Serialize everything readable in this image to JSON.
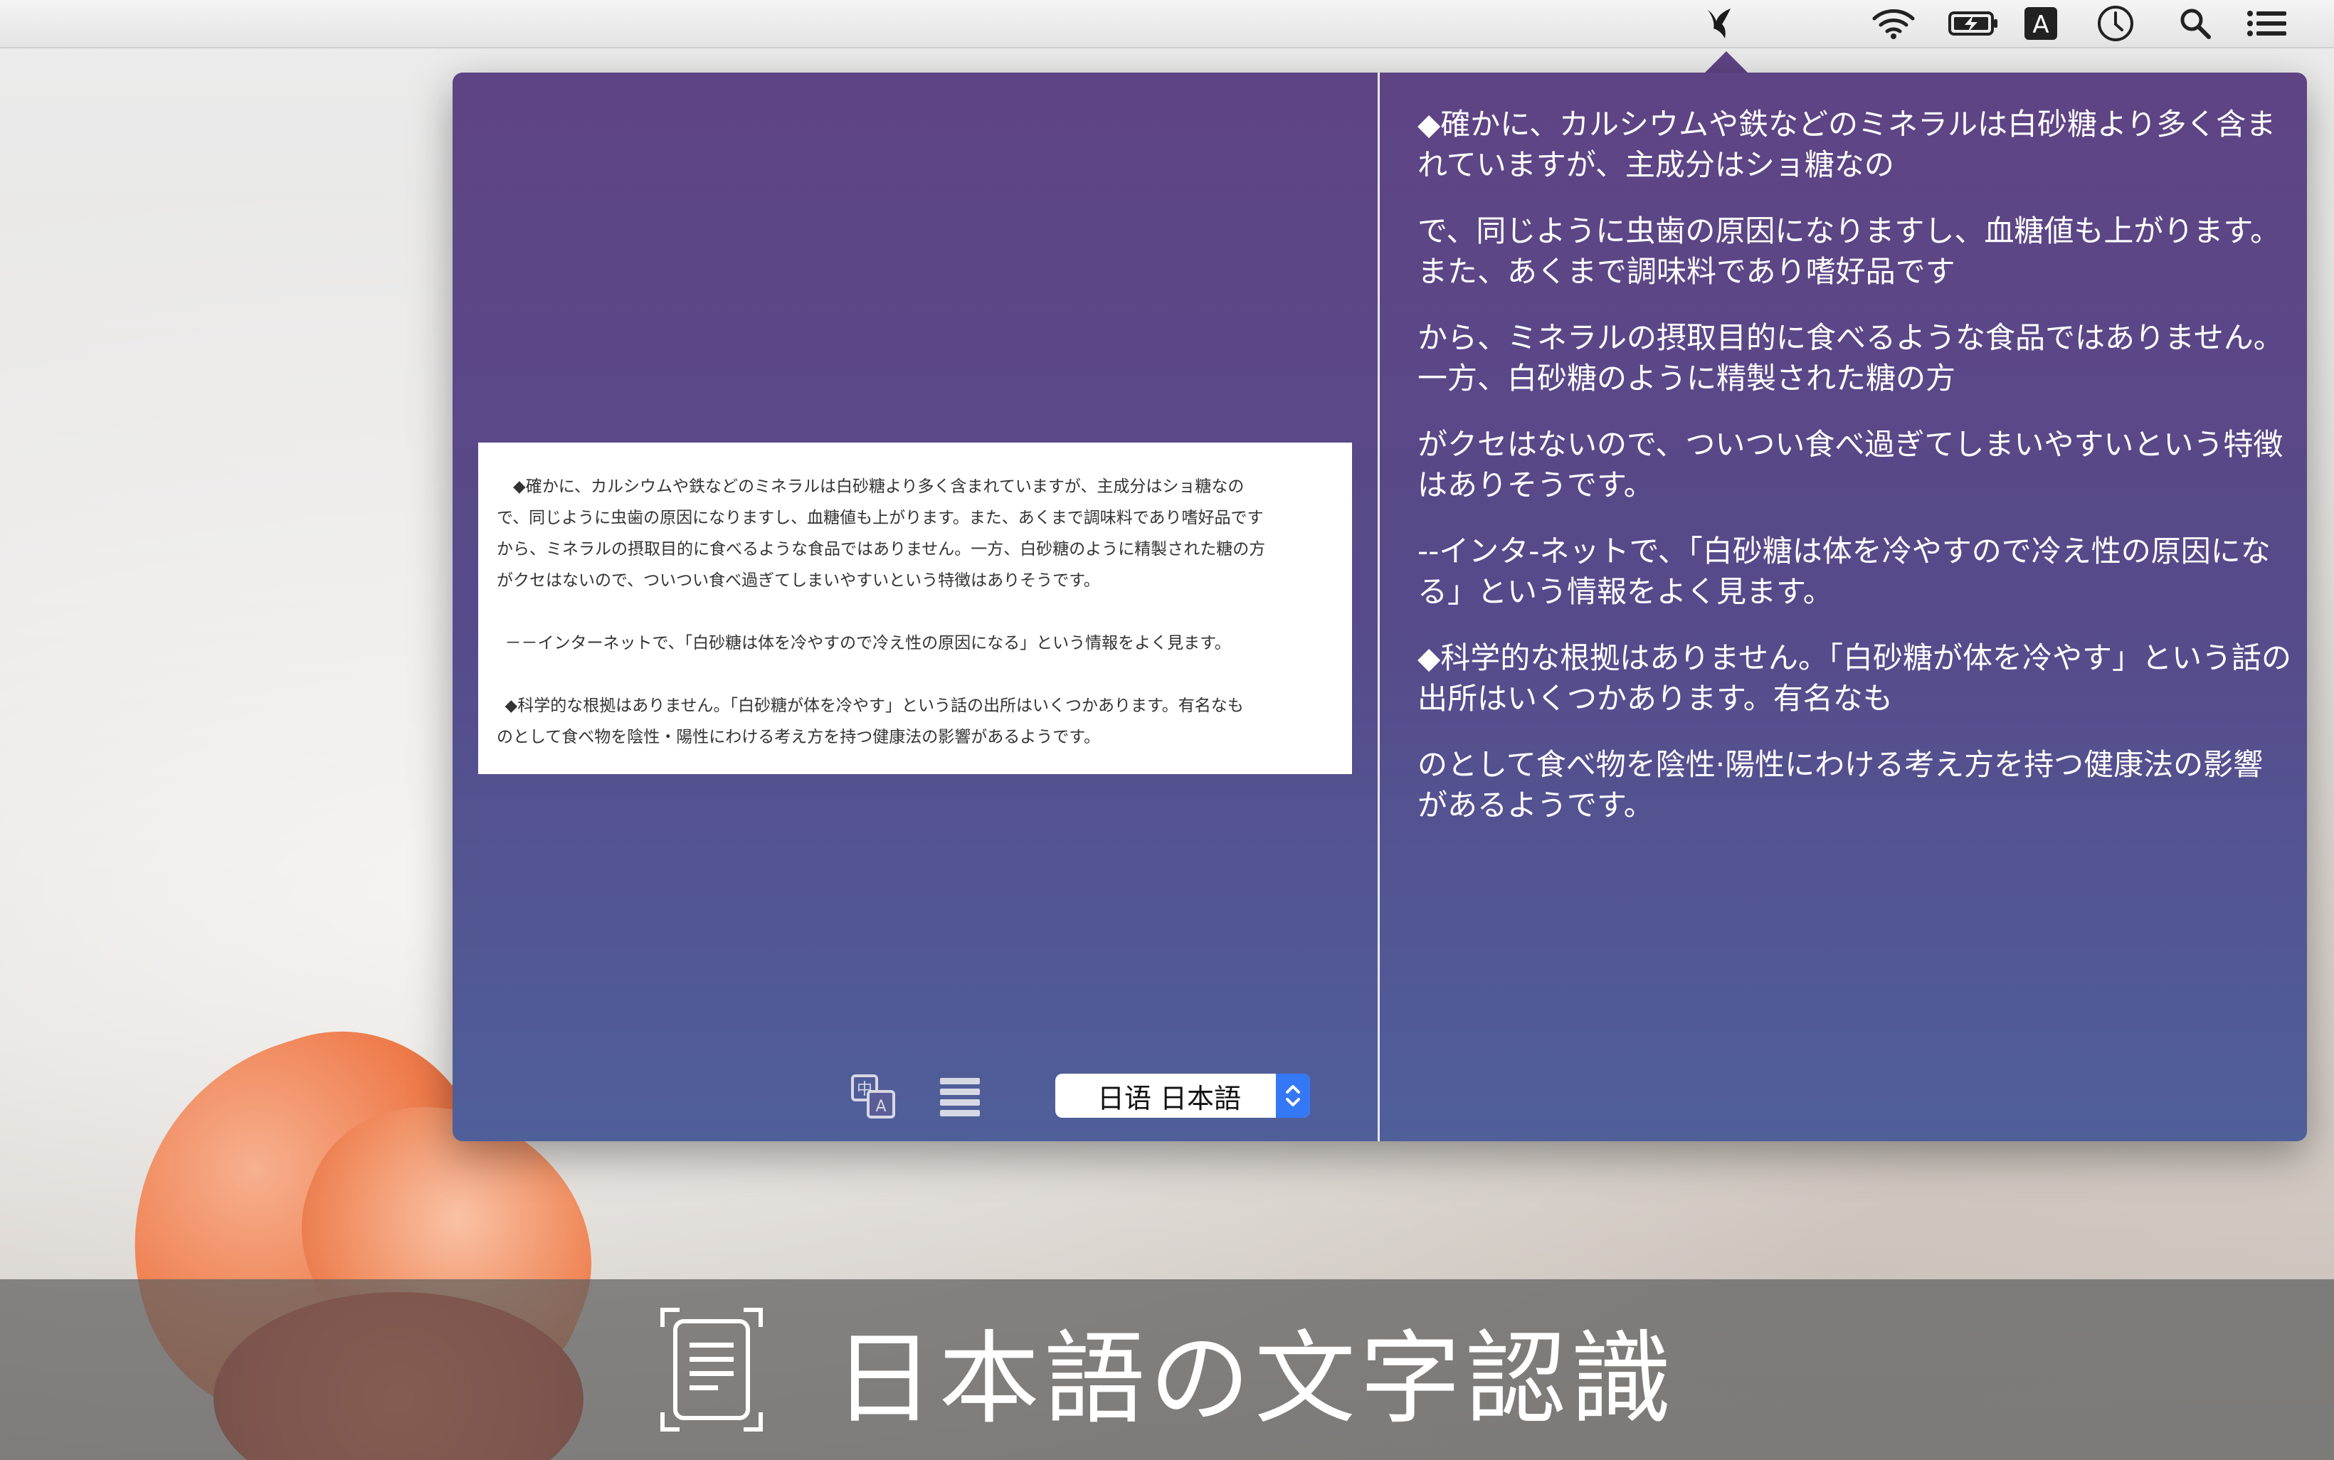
{
  "menubar": {
    "icons": [
      "translator-app-icon",
      "wifi-icon",
      "battery-charging-icon",
      "input-source-icon",
      "clock-icon",
      "spotlight-search-icon",
      "notification-center-icon"
    ],
    "input_source_label": "A"
  },
  "popover": {
    "source_image_text": [
      "◆確かに、カルシウムや鉄などのミネラルは白砂糖より多く含まれていますが、主成分はショ糖なの",
      "で、同じように虫歯の原因になりますし、血糖値も上がります。また、あくまで調味料であり嗜好品です",
      "から、ミネラルの摂取目的に食べるような食品ではありません。一方、白砂糖のように精製された糖の方",
      "がクセはないので、ついつい食べ過ぎてしまいやすいという特徴はありそうです。",
      "－－インターネットで、「白砂糖は体を冷やすので冷え性の原因になる」という情報をよく見ます。",
      "◆科学的な根拠はありません。「白砂糖が体を冷やす」という話の出所はいくつかあります。有名なも",
      "のとして食べ物を陰性・陽性にわける考え方を持つ健康法の影響があるようです。"
    ],
    "toolbar": {
      "translate_icon": "translate-icon",
      "list_icon": "list-icon",
      "language_select": "日语  日本語"
    },
    "result_paragraphs": [
      "◆確かに、カルシウムや鉄などのミネラルは白砂糖より多く含まれていますが、主成分はショ糖なの",
      "で、同じように虫歯の原因になりますし、血糖値も上がります。また、あくまで調味料であり嗜好品です",
      "から、ミネラルの摂取目的に食べるような食品ではありません。一方、白砂糖のように精製された糖の方",
      "がクセはないので、ついつい食べ過ぎてしまいやすいという特徴はありそうです。",
      "--インタ-ネットで、「白砂糖は体を冷やすので冷え性の原因になる」という情報をよく見ます。",
      "◆科学的な根拠はありません。「白砂糖が体を冷やす」という話の出所はいくつかあります。有名なも",
      "のとして食べ物を陰性·陽性にわける考え方を持つ健康法の影響があるようです。"
    ]
  },
  "banner": {
    "title": "日本語の文字認識"
  },
  "colors": {
    "popover_top": "#5f4484",
    "popover_bottom": "#4f5f9a",
    "select_accent": "#3478f6"
  }
}
